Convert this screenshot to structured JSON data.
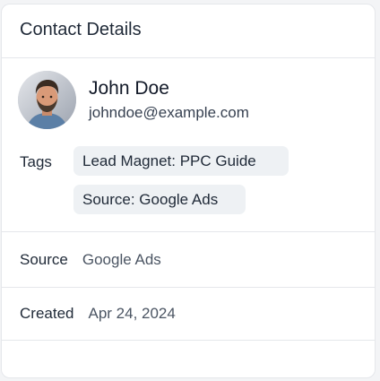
{
  "card": {
    "title": "Contact Details"
  },
  "contact": {
    "name": "John Doe",
    "email": "johndoe@example.com",
    "avatar_icon": "avatar-photo"
  },
  "tags": {
    "label": "Tags",
    "items": [
      {
        "label": "Lead Magnet: PPC Guide"
      },
      {
        "label": "Source: Google Ads"
      }
    ]
  },
  "source": {
    "label": "Source",
    "value": "Google Ads"
  },
  "created": {
    "label": "Created",
    "value": "Apr 24, 2024"
  }
}
